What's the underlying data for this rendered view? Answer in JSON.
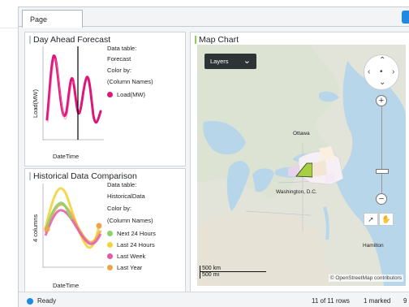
{
  "tab": {
    "label": "Page"
  },
  "day_ahead": {
    "title": "Day Ahead Forecast",
    "data_table_label": "Data table:",
    "data_table_value": "Forecast",
    "color_by_label": "Color by:",
    "color_by_value": "(Column Names)",
    "legend": [
      {
        "label": "Load(MW)",
        "color": "#e0157a"
      }
    ],
    "y_label": "Load(MW)",
    "x_label": "DateTime"
  },
  "historical": {
    "title": "Historical Data Comparison",
    "data_table_label": "Data table:",
    "data_table_value": "HistoricalData",
    "color_by_label": "Color by:",
    "color_by_value": "(Column Names)",
    "legend": [
      {
        "label": "Next 24 Hours",
        "color": "#8fd06a"
      },
      {
        "label": "Last 24 Hours",
        "color": "#f2d43a"
      },
      {
        "label": "Last Week",
        "color": "#e25aa8"
      },
      {
        "label": "Last Year",
        "color": "#f0a34a"
      }
    ],
    "y_label": "4 columns",
    "x_label": "DateTime"
  },
  "map": {
    "title": "Map Chart",
    "layers_label": "Layers",
    "cities": {
      "ottawa": "Ottawa",
      "washington": "Washington, D.C.",
      "hamilton": "Hamilton"
    },
    "scale_km": "500 km",
    "scale_mi": "500 mi",
    "attribution": "© OpenStreetMap contributors"
  },
  "status": {
    "state": "Ready",
    "rows": "11 of 11 rows",
    "marked": "1 marked",
    "trail": "9"
  },
  "colors": {
    "accent": "#1e8ae6",
    "forecast_line": "#e0157a"
  }
}
